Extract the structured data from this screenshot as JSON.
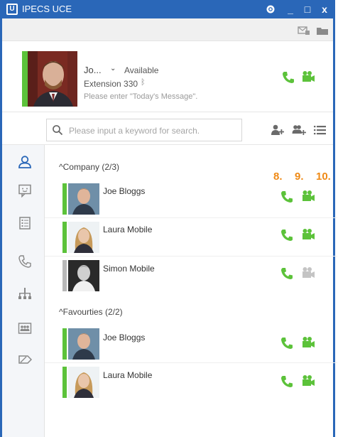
{
  "window": {
    "title": "IPECS UCE",
    "logo_text": "U"
  },
  "titlebar": {
    "settings_icon": "gear-icon",
    "minimize_glyph": "_",
    "maximize_glyph": "□",
    "close_glyph": "x"
  },
  "profile": {
    "name": "Jo...",
    "dropdown_glyph": "⌄",
    "status": "Available",
    "extension": "Extension 330",
    "bluetooth_glyph": "ᛒ",
    "message_placeholder": "Please enter \"Today's Message\".",
    "status_color": "#5cc23a"
  },
  "search": {
    "placeholder": "Please input a keyword for search."
  },
  "callouts": [
    "8.",
    "9.",
    "10."
  ],
  "groups": [
    {
      "header": "^Company (2/3)",
      "contacts": [
        {
          "name": "Joe Bloggs",
          "status_color": "#5cc23a",
          "online": true
        },
        {
          "name": "Laura Mobile",
          "status_color": "#5cc23a",
          "online": true
        },
        {
          "name": "Simon Mobile",
          "status_color": "#b8b8b8",
          "online": false
        }
      ]
    },
    {
      "header": "^Favourties (2/2)",
      "contacts": [
        {
          "name": "Joe Bloggs",
          "status_color": "#5cc23a",
          "online": true
        },
        {
          "name": "Laura Mobile",
          "status_color": "#5cc23a",
          "online": true
        }
      ]
    }
  ],
  "colors": {
    "brand_blue": "#2a67b8",
    "accent_green": "#5cc23a",
    "callout_orange": "#ef8a16",
    "disabled_gray": "#c4c4c4"
  }
}
